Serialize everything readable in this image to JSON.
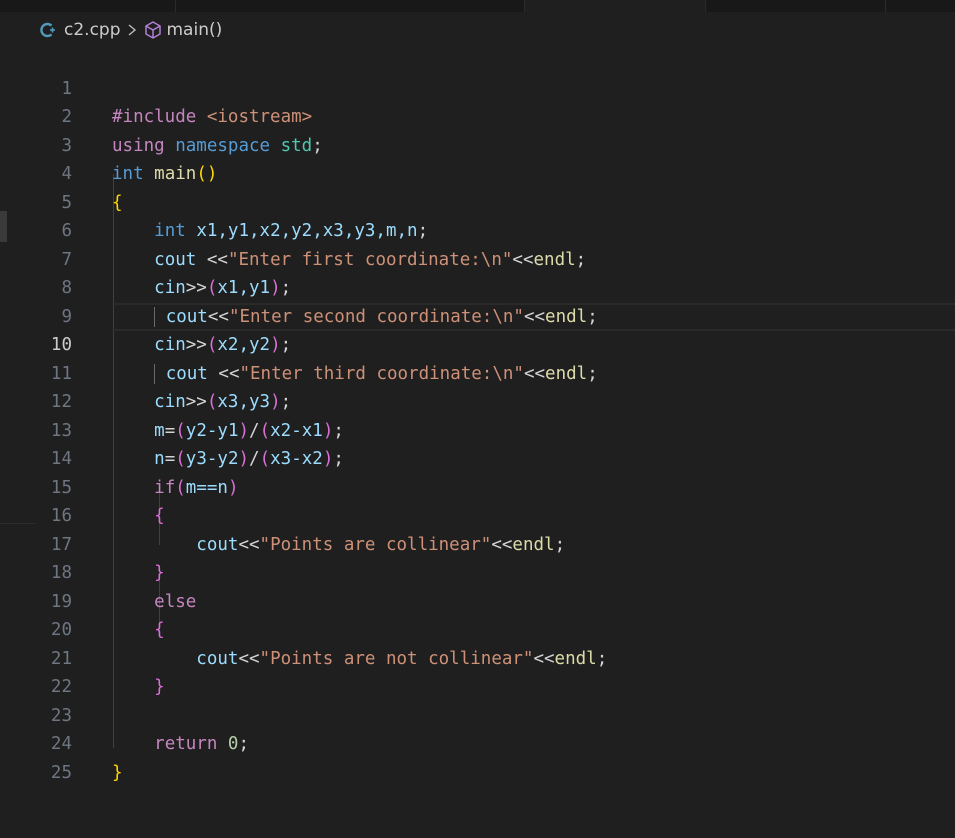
{
  "breadcrumb": {
    "file": "c2.cpp",
    "symbol": "main()",
    "file_icon": "cpp-file-icon",
    "symbol_icon": "method-cube-icon",
    "separator_icon": "chevron-right-icon"
  },
  "editor": {
    "current_line": 10,
    "line_numbers": [
      "1",
      "2",
      "3",
      "4",
      "5",
      "6",
      "7",
      "8",
      "9",
      "10",
      "11",
      "12",
      "13",
      "14",
      "15",
      "16",
      "17",
      "18",
      "19",
      "20",
      "21",
      "22",
      "23",
      "24",
      "25"
    ]
  },
  "colors": {
    "background": "#1f1f1f",
    "keyword": "#569cd6",
    "control": "#c586c0",
    "function": "#dcdcaa",
    "variable": "#9cdcfe",
    "string": "#ce9178",
    "number": "#b5cea8",
    "bracket_gold": "#ffd700",
    "bracket_purple": "#da70d6",
    "bracket_blue": "#179fff"
  },
  "code": {
    "l1_directive": "#include",
    "l1_header": "<iostream>",
    "l2_using": "using",
    "l2_namespace": "namespace",
    "l2_std": "std",
    "l3_int": "int",
    "l3_main": "main",
    "l5_int": "int",
    "l5_vars": "x1,y1,x2,y2,x3,y3,m,n",
    "l6_cout": "cout",
    "l6_str": "\"Enter first coordinate:\\n\"",
    "endl": "endl",
    "cin": "cin",
    "l7_args": "x1,y1",
    "l8_cout": "cout",
    "l8_str": "\"Enter second coordinate:\\n\"",
    "l9_args": "x2,y2",
    "l10_cout": "cout",
    "l10_str": "\"Enter third coordinate:\\n\"",
    "l11_args": "x3,y3",
    "l12_lhs": "m",
    "l12_a": "y2-y1",
    "l12_b": "x2-x1",
    "l13_lhs": "n",
    "l13_a": "y3-y2",
    "l13_b": "x3-x2",
    "l14_if": "if",
    "l14_cond": "m==n",
    "l16_cout": "cout",
    "l16_str": "\"Points are collinear\"",
    "l18_else": "else",
    "l20_cout": "cout",
    "l20_str": "\"Points are not collinear\"",
    "l23_return": "return",
    "l23_zero": "0"
  }
}
